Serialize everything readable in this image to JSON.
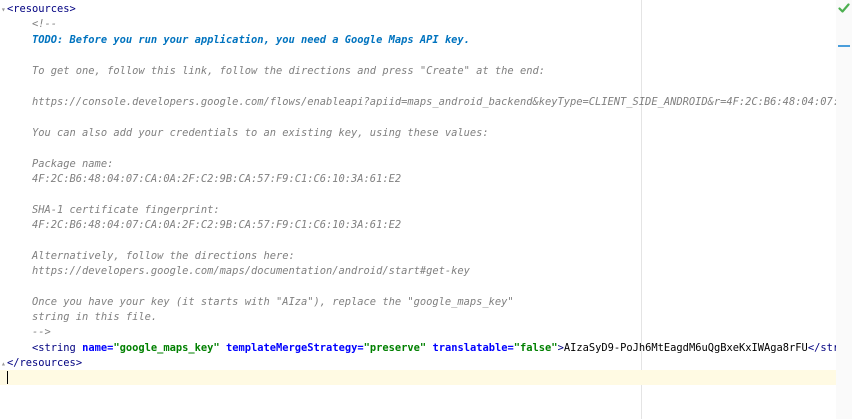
{
  "editor": {
    "lines": {
      "open_resources": "<resources>",
      "comment_open": "<!--",
      "todo": "TODO: Before you run your application, you need a Google Maps API key.",
      "get_one": "To get one, follow this link, follow the directions and press \"Create\" at the end:",
      "url": "https://console.developers.google.com/flows/enableapi?apiid=maps_android_backend&keyType=CLIENT_SIDE_ANDROID&r=4F:2C:B6:48:04:07:",
      "existing_key": "You can also add your credentials to an existing key, using these values:",
      "package_label": "Package name:",
      "package_value": "4F:2C:B6:48:04:07:CA:0A:2F:C2:9B:CA:57:F9:C1:C6:10:3A:61:E2",
      "sha_label": "SHA-1 certificate fingerprint:",
      "sha_value": "4F:2C:B6:48:04:07:CA:0A:2F:C2:9B:CA:57:F9:C1:C6:10:3A:61:E2",
      "alternatively": "Alternatively, follow the directions here:",
      "docs_url": "https://developers.google.com/maps/documentation/android/start#get-key",
      "once_key": "Once you have your key (it starts with \"AIza\"), replace the \"google_maps_key\"",
      "string_in_file": "string in this file.",
      "comment_close": "-->",
      "close_resources": "</resources>"
    },
    "string_element": {
      "open": "<string",
      "attr_name": "name=",
      "val_name": "\"google_maps_key\"",
      "attr_strategy": "templateMergeStrategy=",
      "val_strategy": "\"preserve\"",
      "attr_translatable": "translatable=",
      "val_translatable": "\"false\"",
      "close_bracket": ">",
      "content": "AIzaSyD9-PoJh6MtEagdM6uQgBxeKxIWAga8rFU",
      "end_tag": "</str"
    }
  },
  "colors": {
    "tag": "#000080",
    "attribute": "#0000ff",
    "value": "#008000",
    "comment": "#808080",
    "todo": "#0073bf",
    "current_line": "#fffae3",
    "status_ok": "#4caf50"
  },
  "icons": {
    "status": "check-icon",
    "fold": "fold-marker-icon"
  }
}
